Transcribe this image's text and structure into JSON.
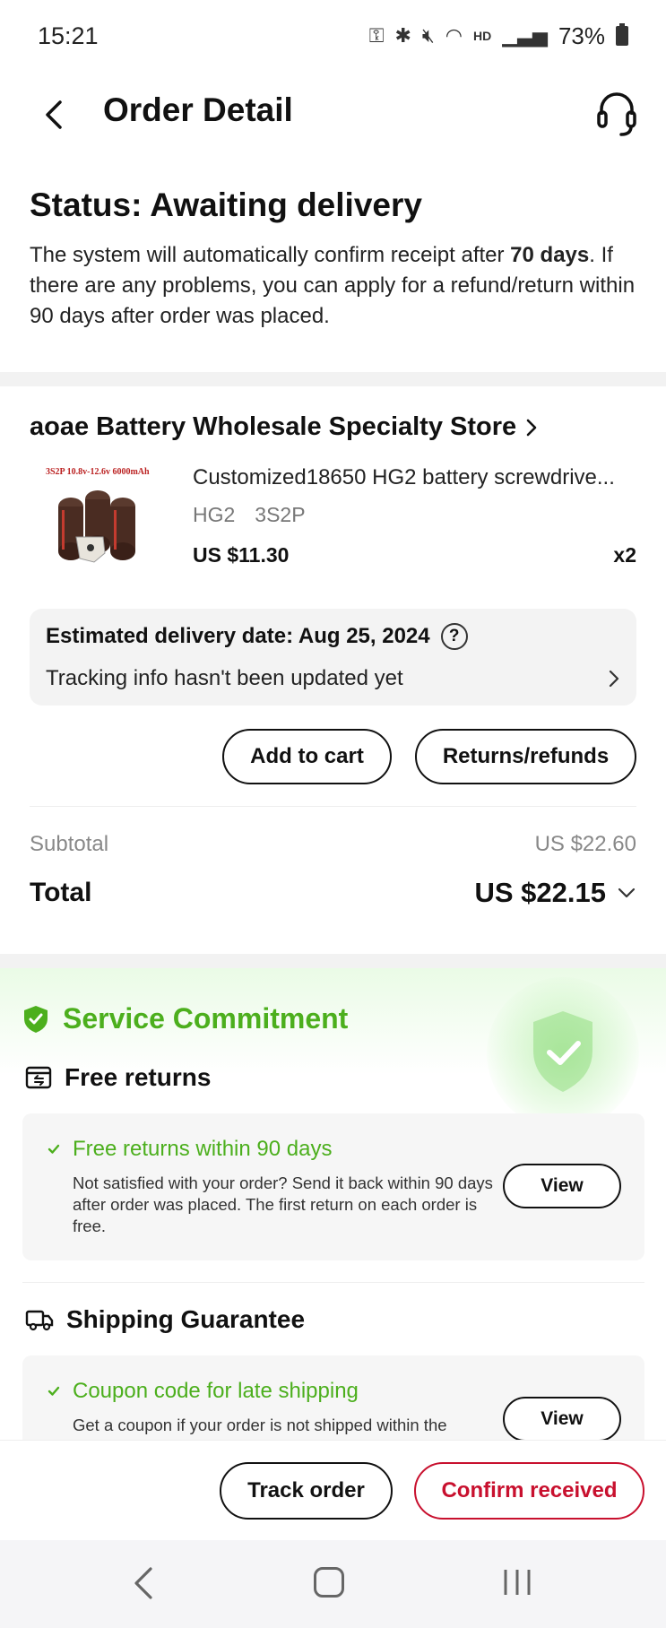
{
  "statusbar": {
    "time": "15:21",
    "battery": "73%"
  },
  "header": {
    "title": "Order Detail"
  },
  "order_status": {
    "title": "Status: Awaiting delivery",
    "desc_prefix": "The system will automatically confirm receipt after ",
    "desc_days": "70 days",
    "desc_suffix": ". If there are any problems, you can apply for a refund/return within 90 days after order was placed."
  },
  "store": {
    "name": "aoae Battery Wholesale Specialty Store"
  },
  "product": {
    "image_label": "3S2P 10.8v-12.6v 6000mAh",
    "name": "Customized18650 HG2 battery  screwdrive...",
    "variant1": "HG2",
    "variant2": "3S2P",
    "price": "US $11.30",
    "qty": "x2"
  },
  "delivery": {
    "estimate": "Estimated delivery date: Aug 25, 2024",
    "tracking": "Tracking info hasn't been updated yet"
  },
  "actions": {
    "add_to_cart": "Add to cart",
    "returns": "Returns/refunds"
  },
  "totals": {
    "subtotal_label": "Subtotal",
    "subtotal_value": "US $22.60",
    "total_label": "Total",
    "total_value": "US $22.15"
  },
  "service": {
    "title": "Service Commitment",
    "free_returns": {
      "heading": "Free returns",
      "item_title": "Free returns within 90 days",
      "item_desc": "Not satisfied with your order? Send it back within 90 days after order was placed. The first return on each order is free.",
      "button": "View"
    },
    "shipping": {
      "heading": "Shipping Guarantee",
      "item_title": "Coupon code for late shipping",
      "item_desc": "Get a coupon if your order is not shipped within the",
      "button": "View"
    }
  },
  "bottom": {
    "track": "Track order",
    "confirm": "Confirm received"
  },
  "colors": {
    "accent_green": "#4caf1d",
    "confirm_red": "#c8102e"
  }
}
